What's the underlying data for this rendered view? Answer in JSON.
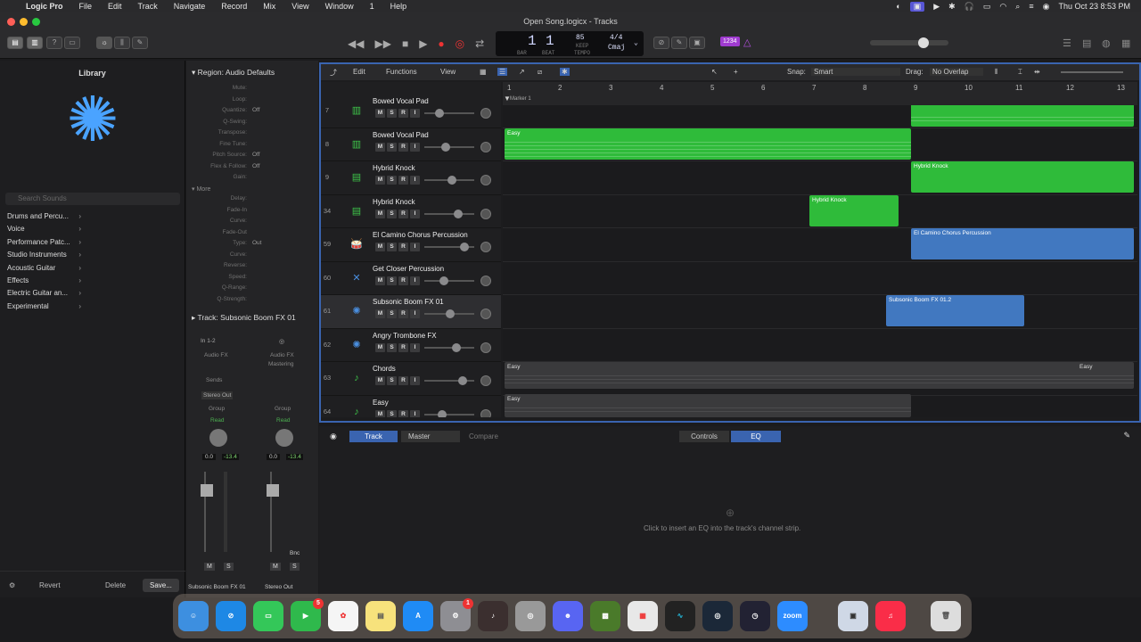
{
  "menubar": {
    "app": "Logic Pro",
    "items": [
      "File",
      "Edit",
      "Track",
      "Navigate",
      "Record",
      "Mix",
      "View",
      "Window",
      "1",
      "Help"
    ],
    "clock": "Thu Oct 23  8:53 PM"
  },
  "window": {
    "title": "Open Song.logicx - Tracks"
  },
  "lcd": {
    "bar": "1",
    "beat": "1",
    "bar_label": "BAR",
    "beat_label": "BEAT",
    "tempo": "85",
    "keep": "KEEP",
    "tempo_label": "TEMPO",
    "signature": "4/4",
    "key": "Cmaj"
  },
  "toolbar": {
    "badge": "1234"
  },
  "library": {
    "title": "Library",
    "search_placeholder": "Search Sounds",
    "categories": [
      "Drums and Percu...",
      "Voice",
      "Performance Patc...",
      "Studio Instruments",
      "Acoustic Guitar",
      "Effects",
      "Electric Guitar an...",
      "Experimental"
    ],
    "revert": "Revert",
    "delete": "Delete",
    "save": "Save..."
  },
  "inspector": {
    "region_label": "Region:",
    "region_name": "Audio Defaults",
    "params": [
      {
        "k": "Mute:",
        "v": ""
      },
      {
        "k": "Loop:",
        "v": ""
      },
      {
        "k": "Quantize:",
        "v": "Off"
      },
      {
        "k": "Q-Swing:",
        "v": ""
      },
      {
        "k": "Transpose:",
        "v": ""
      },
      {
        "k": "Fine Tune:",
        "v": ""
      },
      {
        "k": "Pitch Source:",
        "v": "Off"
      },
      {
        "k": "Flex & Follow:",
        "v": "Off"
      },
      {
        "k": "Gain:",
        "v": ""
      }
    ],
    "more": "More",
    "params2": [
      {
        "k": "Delay:",
        "v": ""
      },
      {
        "k": "Fade-In",
        "v": ""
      },
      {
        "k": "Curve:",
        "v": ""
      },
      {
        "k": "Fade-Out",
        "v": ""
      },
      {
        "k": "Type:",
        "v": "Out"
      },
      {
        "k": "Curve:",
        "v": ""
      },
      {
        "k": "Reverse:",
        "v": ""
      },
      {
        "k": "Speed:",
        "v": ""
      },
      {
        "k": "Q-Range:",
        "v": ""
      },
      {
        "k": "Q-Strength:",
        "v": ""
      }
    ],
    "track_label": "Track:",
    "track_name": "Subsonic Boom FX 01",
    "strip1": {
      "io": "In 1-2",
      "fx": "Audio FX",
      "sends": "Sends",
      "out": "Stereo Out",
      "group": "Group",
      "auto": "Read",
      "val": "0.0",
      "peak": "-13.4",
      "name": "Subsonic Boom FX 01",
      "bnc": ""
    },
    "strip2": {
      "fx": "Audio FX",
      "fx2": "Mastering",
      "group": "Group",
      "auto": "Read",
      "val": "0.0",
      "peak": "-13.4",
      "name": "Stereo Out",
      "bnc": "Bnc"
    }
  },
  "editbar": {
    "edit": "Edit",
    "functions": "Functions",
    "view": "View",
    "snap_label": "Snap:",
    "snap": "Smart",
    "drag_label": "Drag:",
    "drag": "No Overlap"
  },
  "ruler": {
    "bars": [
      "1",
      "2",
      "3",
      "4",
      "5",
      "6",
      "7",
      "8",
      "9",
      "10",
      "11",
      "12",
      "13"
    ],
    "marker": "Marker 1"
  },
  "tracks": [
    {
      "num": "7",
      "name": "Bowed Vocal Pad",
      "icon": "▥",
      "color": "#3ec64a"
    },
    {
      "num": "8",
      "name": "Bowed Vocal Pad",
      "icon": "▥",
      "color": "#3ec64a"
    },
    {
      "num": "9",
      "name": "Hybrid Knock",
      "icon": "▤",
      "color": "#3ec64a"
    },
    {
      "num": "34",
      "name": "Hybrid Knock",
      "icon": "▤",
      "color": "#3ec64a"
    },
    {
      "num": "59",
      "name": "El Camino Chorus Percussion",
      "icon": "🥁",
      "color": "#d86a2a"
    },
    {
      "num": "60",
      "name": "Get Closer Percussion",
      "icon": "✕",
      "color": "#4a8fe0"
    },
    {
      "num": "61",
      "name": "Subsonic Boom FX 01",
      "icon": "✺",
      "color": "#4a8fe0"
    },
    {
      "num": "62",
      "name": "Angry Trombone FX",
      "icon": "✺",
      "color": "#4a8fe0"
    },
    {
      "num": "63",
      "name": "Chords",
      "icon": "♪",
      "color": "#3ec64a"
    },
    {
      "num": "64",
      "name": "Easy",
      "icon": "♪",
      "color": "#3ec64a"
    }
  ],
  "regions": {
    "easy": "Easy",
    "hybrid": "Hybrid Knock",
    "elcamino": "El Camino Chorus Percussion",
    "subsonic": "Subsonic Boom FX 01.2"
  },
  "bottom": {
    "track": "Track",
    "master": "Master",
    "compare": "Compare",
    "controls": "Controls",
    "eq": "EQ",
    "hint": "Click to insert an EQ into the track's channel strip."
  },
  "dock": {
    "messages_badge": "5",
    "settings_badge": "1",
    "zoom": "zoom"
  }
}
